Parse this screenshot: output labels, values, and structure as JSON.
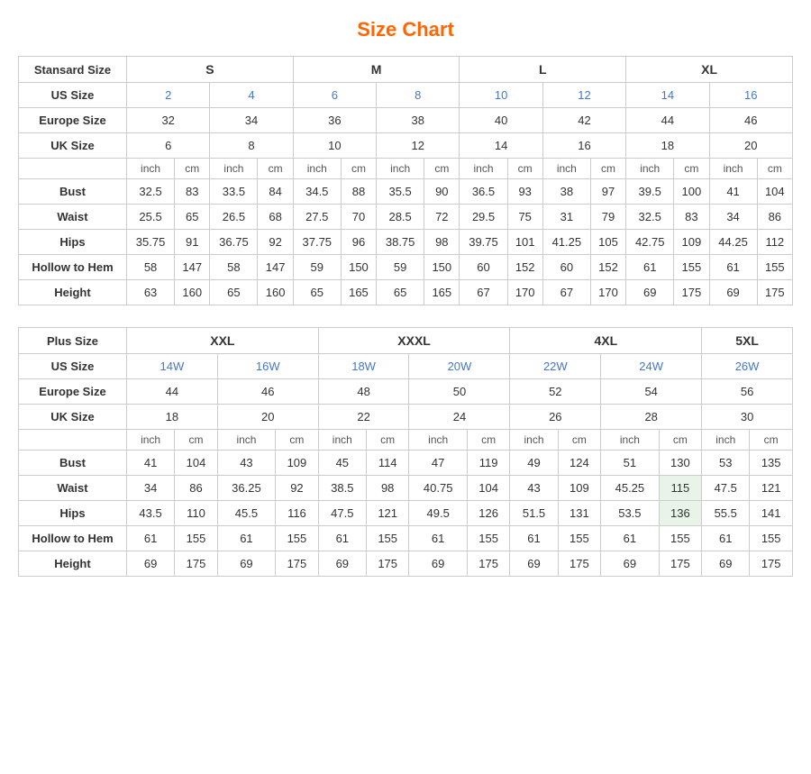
{
  "title": "Size Chart",
  "standard": {
    "headers": {
      "label": "Stansard Size",
      "s": "S",
      "m": "M",
      "l": "L",
      "xl": "XL"
    },
    "usSize": {
      "label": "US Size",
      "values": [
        "2",
        "4",
        "6",
        "8",
        "10",
        "12",
        "14",
        "16"
      ]
    },
    "europeSize": {
      "label": "Europe Size",
      "values": [
        "32",
        "34",
        "36",
        "38",
        "40",
        "42",
        "44",
        "46"
      ]
    },
    "ukSize": {
      "label": "UK Size",
      "values": [
        "6",
        "8",
        "10",
        "12",
        "14",
        "16",
        "18",
        "20"
      ]
    },
    "units": [
      "inch",
      "cm",
      "inch",
      "cm",
      "inch",
      "cm",
      "inch",
      "cm",
      "inch",
      "cm",
      "inch",
      "cm",
      "inch",
      "cm",
      "inch",
      "cm"
    ],
    "bust": {
      "label": "Bust",
      "values": [
        "32.5",
        "83",
        "33.5",
        "84",
        "34.5",
        "88",
        "35.5",
        "90",
        "36.5",
        "93",
        "38",
        "97",
        "39.5",
        "100",
        "41",
        "104"
      ]
    },
    "waist": {
      "label": "Waist",
      "values": [
        "25.5",
        "65",
        "26.5",
        "68",
        "27.5",
        "70",
        "28.5",
        "72",
        "29.5",
        "75",
        "31",
        "79",
        "32.5",
        "83",
        "34",
        "86"
      ]
    },
    "hips": {
      "label": "Hips",
      "values": [
        "35.75",
        "91",
        "36.75",
        "92",
        "37.75",
        "96",
        "38.75",
        "98",
        "39.75",
        "101",
        "41.25",
        "105",
        "42.75",
        "109",
        "44.25",
        "112"
      ]
    },
    "hollow": {
      "label": "Hollow to Hem",
      "values": [
        "58",
        "147",
        "58",
        "147",
        "59",
        "150",
        "59",
        "150",
        "60",
        "152",
        "60",
        "152",
        "61",
        "155",
        "61",
        "155"
      ]
    },
    "height": {
      "label": "Height",
      "values": [
        "63",
        "160",
        "65",
        "160",
        "65",
        "165",
        "65",
        "165",
        "67",
        "170",
        "67",
        "170",
        "69",
        "175",
        "69",
        "175"
      ]
    }
  },
  "plus": {
    "headers": {
      "label": "Plus Size",
      "xxl": "XXL",
      "xxxl": "XXXL",
      "4xl": "4XL",
      "5xl": "5XL"
    },
    "usSize": {
      "label": "US Size",
      "values": [
        "14W",
        "16W",
        "18W",
        "20W",
        "22W",
        "24W",
        "26W"
      ]
    },
    "europeSize": {
      "label": "Europe Size",
      "values": [
        "44",
        "46",
        "48",
        "50",
        "52",
        "54",
        "56"
      ]
    },
    "ukSize": {
      "label": "UK Size",
      "values": [
        "18",
        "20",
        "22",
        "24",
        "26",
        "28",
        "30"
      ]
    },
    "units": [
      "inch",
      "cm",
      "inch",
      "cm",
      "inch",
      "cm",
      "inch",
      "cm",
      "inch",
      "cm",
      "inch",
      "cm",
      "inch",
      "cm"
    ],
    "bust": {
      "label": "Bust",
      "values": [
        "41",
        "104",
        "43",
        "109",
        "45",
        "114",
        "47",
        "119",
        "49",
        "124",
        "51",
        "130",
        "53",
        "135"
      ]
    },
    "waist": {
      "label": "Waist",
      "values": [
        "34",
        "86",
        "36.25",
        "92",
        "38.5",
        "98",
        "40.75",
        "104",
        "43",
        "109",
        "45.25",
        "115",
        "47.5",
        "121"
      ]
    },
    "hips": {
      "label": "Hips",
      "values": [
        "43.5",
        "110",
        "45.5",
        "116",
        "47.5",
        "121",
        "49.5",
        "126",
        "51.5",
        "131",
        "53.5",
        "136",
        "55.5",
        "141"
      ]
    },
    "hollow": {
      "label": "Hollow to Hem",
      "values": [
        "61",
        "155",
        "61",
        "155",
        "61",
        "155",
        "61",
        "155",
        "61",
        "155",
        "61",
        "155",
        "61",
        "155"
      ]
    },
    "height": {
      "label": "Height",
      "values": [
        "69",
        "175",
        "69",
        "175",
        "69",
        "175",
        "69",
        "175",
        "69",
        "175",
        "69",
        "175",
        "69",
        "175"
      ]
    }
  }
}
